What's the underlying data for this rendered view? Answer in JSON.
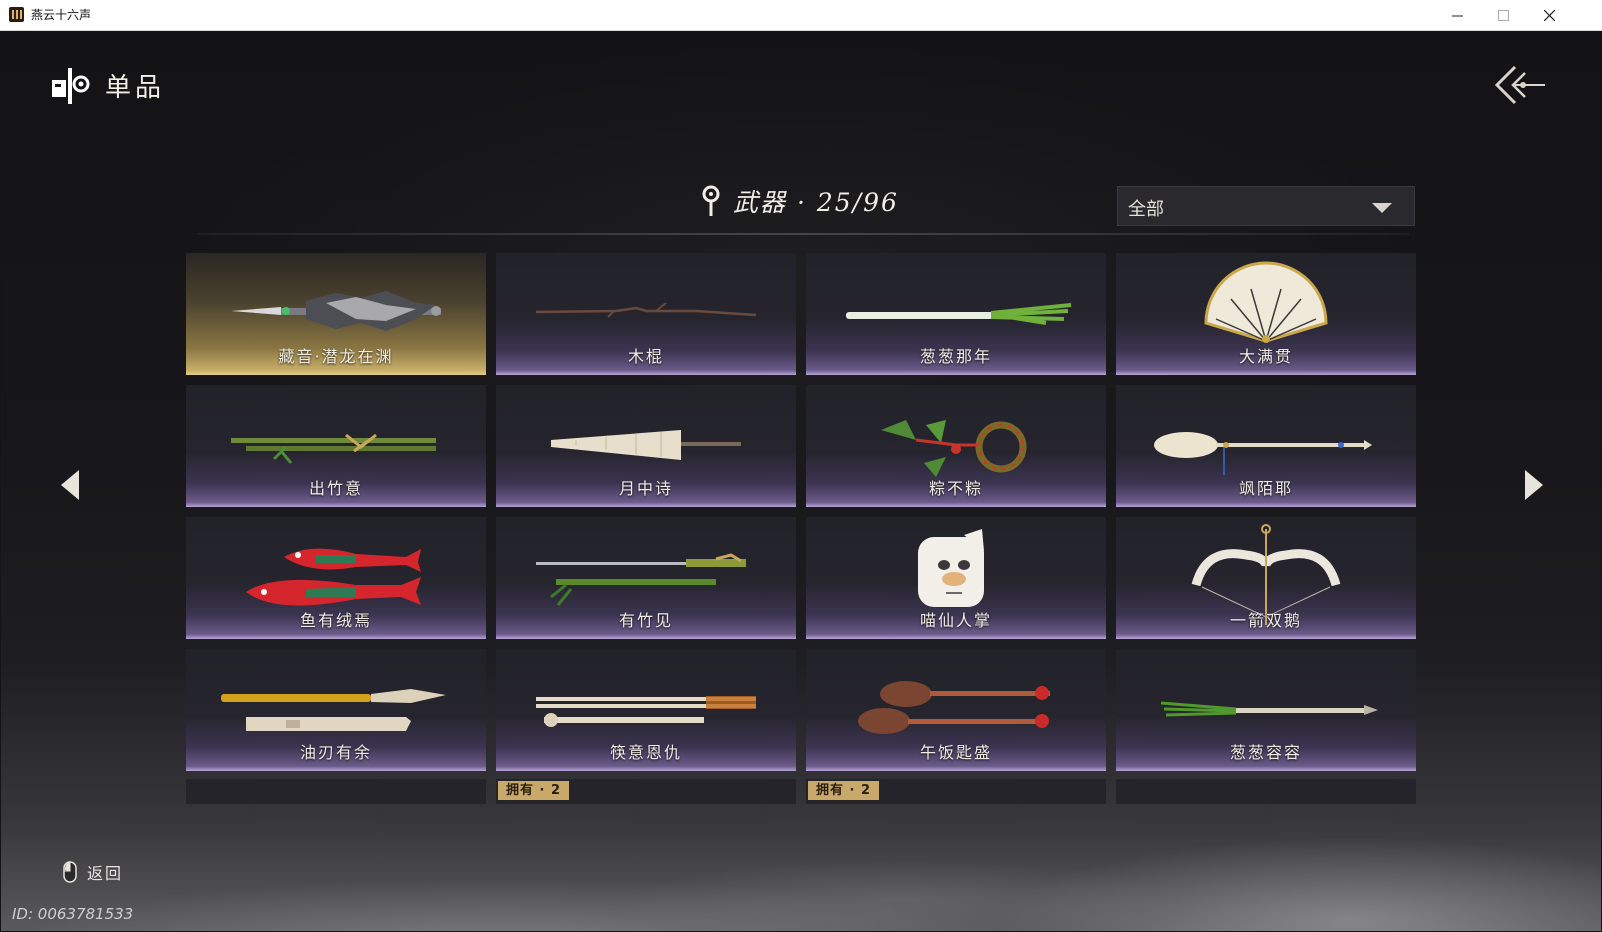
{
  "window": {
    "title": "燕云十六声",
    "minimize_icon": "minimize-icon",
    "maximize_icon": "maximize-icon",
    "close_icon": "close-icon"
  },
  "header": {
    "icon": "collection-icon",
    "title": "单品",
    "back_icon": "back-arrow-icon"
  },
  "category": {
    "icon": "location-pin-icon",
    "label": "武器 · 25/96"
  },
  "filter": {
    "value": "全部",
    "icon": "chevron-down-icon"
  },
  "items": [
    {
      "name": "藏音·潜龙在渊",
      "art": "ornate-spear",
      "selected": true
    },
    {
      "name": "木棍",
      "art": "wooden-stick",
      "selected": false
    },
    {
      "name": "葱葱那年",
      "art": "green-onion",
      "selected": false
    },
    {
      "name": "大满贯",
      "art": "folding-fan",
      "selected": false
    },
    {
      "name": "出竹意",
      "art": "bamboo-staff",
      "selected": false
    },
    {
      "name": "月中诗",
      "art": "paper-umbrella",
      "selected": false
    },
    {
      "name": "粽不粽",
      "art": "zongzi-whip",
      "selected": false
    },
    {
      "name": "飒陌耶",
      "art": "ivory-spoon-spear",
      "selected": false
    },
    {
      "name": "鱼有绒焉",
      "art": "red-fish-blades",
      "selected": false
    },
    {
      "name": "有竹见",
      "art": "bamboo-sword",
      "selected": false
    },
    {
      "name": "喵仙人掌",
      "art": "cat-paw",
      "selected": false
    },
    {
      "name": "一箭双鹅",
      "art": "goose-bow",
      "selected": false
    },
    {
      "name": "油刃有余",
      "art": "fried-dough-blades",
      "selected": false
    },
    {
      "name": "筷意恩仇",
      "art": "chopsticks",
      "selected": false
    },
    {
      "name": "午饭匙盛",
      "art": "wooden-ladles",
      "selected": false
    },
    {
      "name": "葱葱容容",
      "art": "scallion-spear",
      "selected": false
    }
  ],
  "partial_items": [
    {
      "badge": ""
    },
    {
      "badge": "拥有 · 2"
    },
    {
      "badge": "拥有 · 2"
    },
    {
      "badge": ""
    }
  ],
  "navigation": {
    "prev_icon": "triangle-left-icon",
    "next_icon": "triangle-right-icon"
  },
  "footer": {
    "back_icon": "mouse-icon",
    "back_label": "返回",
    "user_id": "ID: 0063781533"
  }
}
